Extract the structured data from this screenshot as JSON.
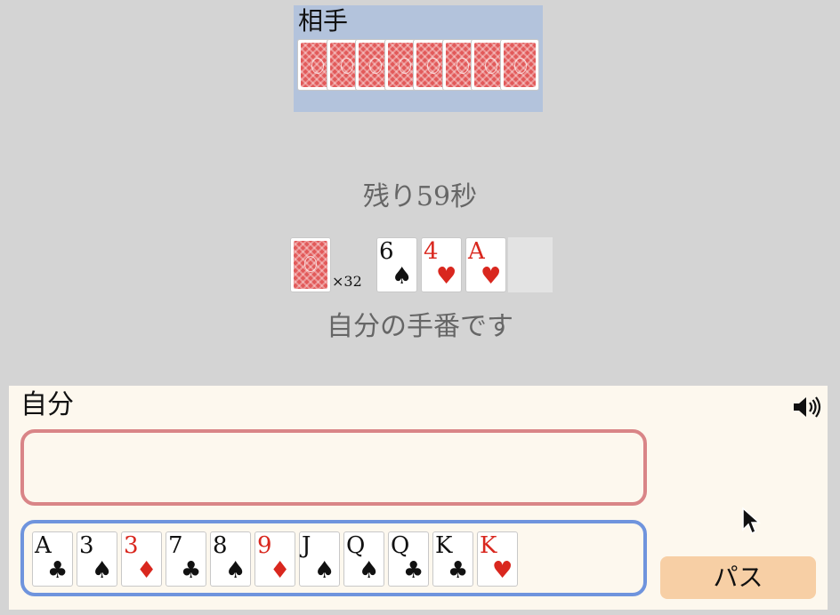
{
  "opponent": {
    "label": "相手",
    "hand_count": 8
  },
  "table": {
    "timer_text": "残り59秒",
    "deck_count_text": "×32",
    "field_cards": [
      {
        "rank": "6",
        "suit": "♠",
        "color": "black"
      },
      {
        "rank": "4",
        "suit": "♥",
        "color": "red"
      },
      {
        "rank": "A",
        "suit": "♥",
        "color": "red"
      }
    ],
    "turn_text": "自分の手番です"
  },
  "player": {
    "label": "自分",
    "hand": [
      {
        "rank": "A",
        "suit": "♣",
        "color": "black"
      },
      {
        "rank": "3",
        "suit": "♠",
        "color": "black"
      },
      {
        "rank": "3",
        "suit": "♦",
        "color": "red"
      },
      {
        "rank": "7",
        "suit": "♣",
        "color": "black"
      },
      {
        "rank": "8",
        "suit": "♠",
        "color": "black"
      },
      {
        "rank": "9",
        "suit": "♦",
        "color": "red"
      },
      {
        "rank": "J",
        "suit": "♠",
        "color": "black"
      },
      {
        "rank": "Q",
        "suit": "♠",
        "color": "black"
      },
      {
        "rank": "Q",
        "suit": "♣",
        "color": "black"
      },
      {
        "rank": "K",
        "suit": "♣",
        "color": "black"
      },
      {
        "rank": "K",
        "suit": "♥",
        "color": "red"
      }
    ],
    "pass_label": "パス",
    "sound_icon": "speaker-icon"
  },
  "colors": {
    "background": "#d4d4d4",
    "opponent_panel": "#b3c3dc",
    "player_panel": "#fdf8ee",
    "play_area_border": "#d98587",
    "hand_area_border": "#6f94dd",
    "pass_button": "#f7cfa5",
    "red_suit": "#d9271e",
    "card_back": "#e25a5a"
  }
}
